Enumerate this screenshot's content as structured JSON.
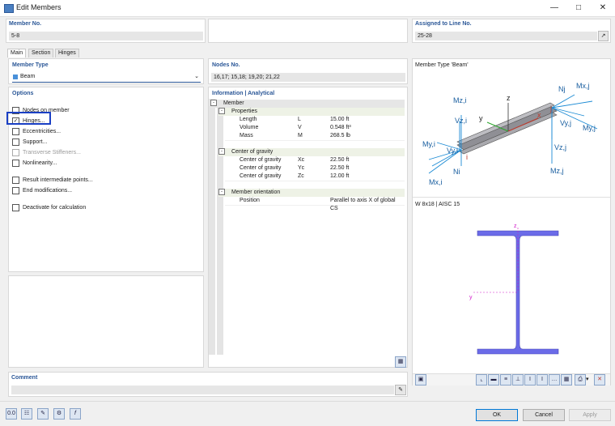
{
  "window": {
    "title": "Edit Members"
  },
  "header": {
    "member_no_label": "Member No.",
    "member_no_value": "5-8",
    "assigned_label": "Assigned to Line No.",
    "assigned_value": "25-28"
  },
  "tabs": [
    {
      "label": "Main"
    },
    {
      "label": "Section"
    },
    {
      "label": "Hinges"
    }
  ],
  "left": {
    "member_type_label": "Member Type",
    "member_type_value": "Beam",
    "options_label": "Options",
    "options": [
      {
        "label": "Nodes on member",
        "checked": false,
        "disabled": false
      },
      {
        "label": "Hinges...",
        "checked": true,
        "disabled": false
      },
      {
        "label": "Eccentricities...",
        "checked": false,
        "disabled": false
      },
      {
        "label": "Support...",
        "checked": false,
        "disabled": false
      },
      {
        "label": "Transverse Stiffeners...",
        "checked": false,
        "disabled": true
      },
      {
        "label": "Nonlinearity...",
        "checked": false,
        "disabled": false
      },
      {
        "label": "Result intermediate points...",
        "checked": false,
        "disabled": false
      },
      {
        "label": "End modifications...",
        "checked": false,
        "disabled": false
      },
      {
        "label": "Deactivate for calculation",
        "checked": false,
        "disabled": false
      }
    ]
  },
  "middle": {
    "nodes_label": "Nodes No.",
    "nodes_value": "16,17; 15,18; 19,20; 21,22",
    "info_label": "Information | Analytical",
    "tree": {
      "root": "Member",
      "properties": {
        "label": "Properties",
        "rows": [
          {
            "name": "Length",
            "sym": "L",
            "value": "15.00 ft"
          },
          {
            "name": "Volume",
            "sym": "V",
            "value": "0.548 ft³"
          },
          {
            "name": "Mass",
            "sym": "M",
            "value": "268.5 lb"
          }
        ]
      },
      "cog": {
        "label": "Center of gravity",
        "rows": [
          {
            "name": "Center of gravity",
            "sym": "Xc",
            "value": "22.50 ft"
          },
          {
            "name": "Center of gravity",
            "sym": "Yc",
            "value": "22.50 ft"
          },
          {
            "name": "Center of gravity",
            "sym": "Zc",
            "value": "12.00 ft"
          }
        ]
      },
      "orient": {
        "label": "Member orientation",
        "rows": [
          {
            "name": "Position",
            "sym": "",
            "value": "Parallel to axis X of global CS"
          }
        ]
      }
    }
  },
  "right": {
    "type_caption": "Member Type 'Beam'",
    "section_caption": "W 8x18 | AISC 15",
    "diagram_labels": {
      "mzi": "Mz,i",
      "z": "z",
      "nj": "Nj",
      "mxj": "Mx,j",
      "j": "j",
      "vzi": "Vz,i",
      "y": "y",
      "x": "x",
      "vyj": "Vy,j",
      "myj": "My,j",
      "myi": "My,i",
      "vyi": "Vy,i",
      "i": "i",
      "vzj": "Vz,j",
      "ni": "Ni",
      "mzj": "Mz,j",
      "mxi": "Mx,i"
    },
    "section_labels": {
      "z": "z",
      "y": "y"
    }
  },
  "comment": {
    "label": "Comment",
    "value": ""
  },
  "footer": {
    "ok": "OK",
    "cancel": "Cancel",
    "apply": "Apply"
  },
  "colors": {
    "accent": "#2b5797",
    "highlight_box": "#1a3fc4",
    "section_fill": "#6b6be8",
    "beam_arrow": "#1a8ad4"
  }
}
